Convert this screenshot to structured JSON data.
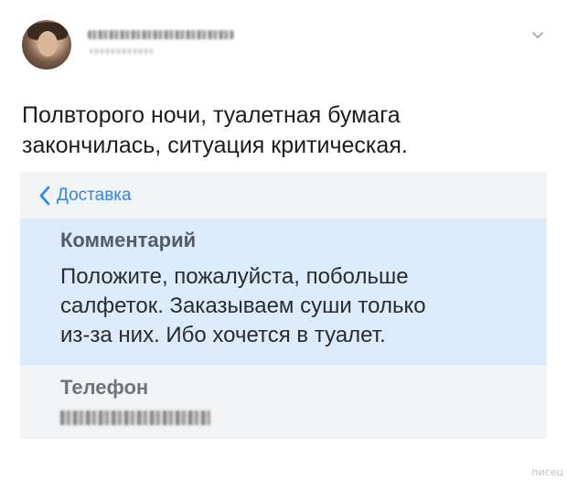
{
  "tweet": {
    "text": "Полвторого ночи, туалетная бумага\nзакончилась, ситуация критическая."
  },
  "app": {
    "back_label": "Доставка",
    "comment": {
      "title": "Комментарий",
      "text": "Положите, пожалуйста, побольше\nсалфеток. Заказываем суши только\nиз-за них. Ибо хочется в туалет."
    },
    "phone": {
      "title": "Телефон"
    }
  },
  "watermark": "писец",
  "colors": {
    "accent": "#2f86e4",
    "comment_bg": "#dcebfb",
    "card_bg": "#f2f3f5"
  },
  "icons": {
    "back": "chevron-left-icon",
    "menu": "chevron-down-icon"
  }
}
